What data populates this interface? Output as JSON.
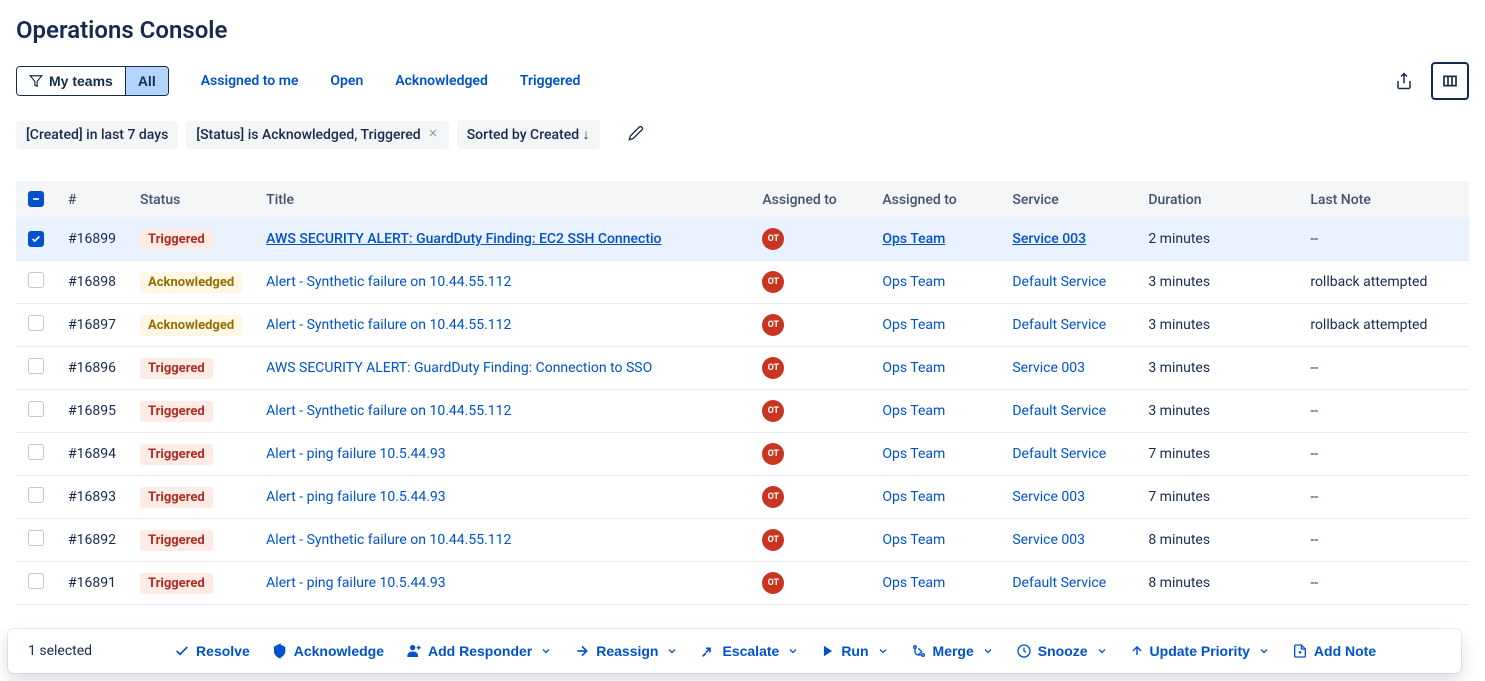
{
  "page_title": "Operations Console",
  "segmented": {
    "my_teams": "My teams",
    "all": "All"
  },
  "tab_links": [
    "Assigned to me",
    "Open",
    "Acknowledged",
    "Triggered"
  ],
  "chips": {
    "created": "[Created] in last 7 days",
    "status": "[Status] is Acknowledged, Triggered",
    "sorted": "Sorted by Created ↓"
  },
  "columns": [
    "#",
    "Status",
    "Title",
    "Assigned to",
    "Assigned to",
    "Service",
    "Duration",
    "Last Note"
  ],
  "avatar_initials": "OT",
  "assignee_name": "Ops Team",
  "rows": [
    {
      "selected": true,
      "num": "#16899",
      "status": "Triggered",
      "title": "AWS SECURITY ALERT: GuardDuty Finding: EC2 SSH Connectio",
      "service": "Service 003",
      "duration": "2 minutes",
      "last_note": "--"
    },
    {
      "selected": false,
      "num": "#16898",
      "status": "Acknowledged",
      "title": "Alert - Synthetic failure on 10.44.55.112",
      "service": "Default Service",
      "duration": "3 minutes",
      "last_note": "rollback attempted"
    },
    {
      "selected": false,
      "num": "#16897",
      "status": "Acknowledged",
      "title": "Alert - Synthetic failure on 10.44.55.112",
      "service": "Default Service",
      "duration": "3 minutes",
      "last_note": "rollback attempted"
    },
    {
      "selected": false,
      "num": "#16896",
      "status": "Triggered",
      "title": "AWS SECURITY ALERT: GuardDuty Finding: Connection to SSO",
      "service": "Service 003",
      "duration": "3 minutes",
      "last_note": "--"
    },
    {
      "selected": false,
      "num": "#16895",
      "status": "Triggered",
      "title": "Alert - Synthetic failure on 10.44.55.112",
      "service": "Default Service",
      "duration": "3 minutes",
      "last_note": "--"
    },
    {
      "selected": false,
      "num": "#16894",
      "status": "Triggered",
      "title": "Alert - ping failure 10.5.44.93",
      "service": "Default Service",
      "duration": "7 minutes",
      "last_note": "--"
    },
    {
      "selected": false,
      "num": "#16893",
      "status": "Triggered",
      "title": "Alert - ping failure 10.5.44.93",
      "service": "Service 003",
      "duration": "7 minutes",
      "last_note": "--"
    },
    {
      "selected": false,
      "num": "#16892",
      "status": "Triggered",
      "title": "Alert - Synthetic failure on 10.44.55.112",
      "service": "Service 003",
      "duration": "8 minutes",
      "last_note": "--"
    },
    {
      "selected": false,
      "num": "#16891",
      "status": "Triggered",
      "title": "Alert - ping failure 10.5.44.93",
      "service": "Default Service",
      "duration": "8 minutes",
      "last_note": "--"
    }
  ],
  "selected_count": "1 selected",
  "actions": {
    "resolve": "Resolve",
    "acknowledge": "Acknowledge",
    "add_responder": "Add Responder",
    "reassign": "Reassign",
    "escalate": "Escalate",
    "run": "Run",
    "merge": "Merge",
    "snooze": "Snooze",
    "update_priority": "Update Priority",
    "add_note": "Add Note"
  }
}
